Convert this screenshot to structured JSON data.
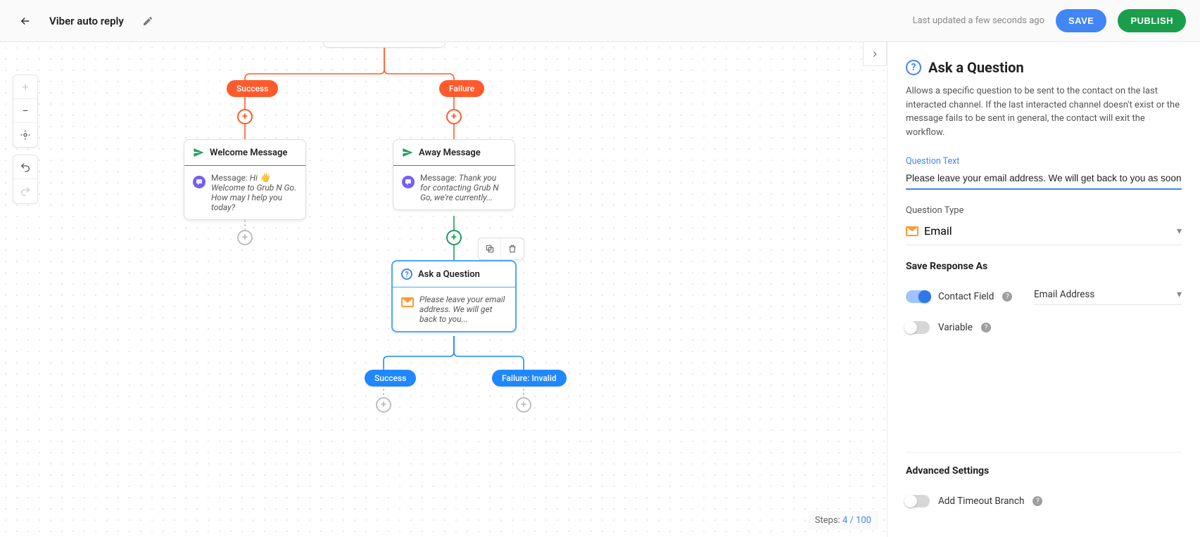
{
  "header": {
    "title": "Viber auto reply",
    "last_updated": "Last updated a few seconds ago",
    "save_label": "SAVE",
    "publish_label": "PUBLISH"
  },
  "canvas": {
    "steps_label": "Steps:",
    "steps_value": "4 / 100",
    "pill_success": "Success",
    "pill_failure": "Failure",
    "pill_success2": "Success",
    "pill_failure_invalid": "Failure: Invalid",
    "node_welcome": {
      "title": "Welcome Message",
      "msg_prefix": "Message: ",
      "msg_text": "Hi 👋 Welcome to Grub N Go. How may I help you today?"
    },
    "node_away": {
      "title": "Away Message",
      "msg_prefix": "Message: ",
      "msg_text": "Thank you for contacting Grub N Go, we're currently..."
    },
    "node_ask": {
      "title": "Ask a Question",
      "msg_text": "Please leave your email address. We will get back to you..."
    }
  },
  "panel": {
    "title": "Ask a Question",
    "description": "Allows a specific question to be sent to the contact on the last interacted channel. If the last interacted channel doesn't exist or the message fails to be sent in general, the contact will exit the workflow.",
    "question_text_label": "Question Text",
    "question_text_value": "Please leave your email address. We will get back to you as soon as possible.",
    "question_type_label": "Question Type",
    "question_type_value": "Email",
    "save_response_label": "Save Response As",
    "contact_field_label": "Contact Field",
    "contact_field_value": "Email Address",
    "variable_label": "Variable",
    "advanced_label": "Advanced Settings",
    "timeout_label": "Add Timeout Branch"
  }
}
